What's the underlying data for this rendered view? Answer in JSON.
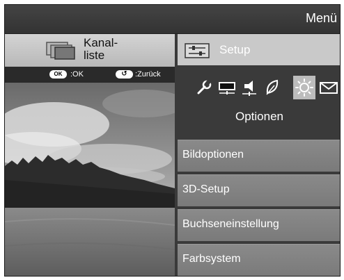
{
  "header": {
    "title": "Menü"
  },
  "kanalliste": {
    "label_line1": "Kanal-",
    "label_line2": "liste"
  },
  "hints": [
    {
      "key": "OK",
      "text": ":OK"
    },
    {
      "key": "↺",
      "text": ":Zurück"
    }
  ],
  "setup": {
    "label": "Setup"
  },
  "category_icons": [
    {
      "name": "wrench-icon",
      "selected": false
    },
    {
      "name": "monitor-icon",
      "selected": false
    },
    {
      "name": "speaker-icon",
      "selected": false
    },
    {
      "name": "leaf-icon",
      "selected": false
    },
    {
      "name": "sun-icon",
      "selected": true
    },
    {
      "name": "envelope-icon",
      "selected": false
    }
  ],
  "section_title": "Optionen",
  "menu_items": [
    {
      "label": "Bildoptionen"
    },
    {
      "label": "3D-Setup"
    },
    {
      "label": "Buchseneinstellung"
    },
    {
      "label": "Farbsystem"
    }
  ],
  "colors": {
    "background": "#3a3a3a",
    "menu_item": "#858585",
    "setup_bar": "#c9c9c9",
    "selected_icon_bg": "#bcbcbc"
  }
}
